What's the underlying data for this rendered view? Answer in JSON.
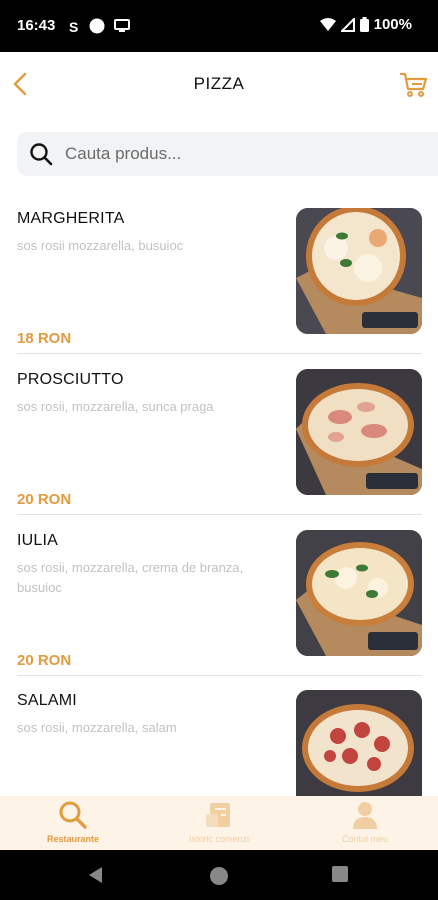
{
  "status": {
    "time": "16:43",
    "battery": "100%"
  },
  "header": {
    "title": "PIZZA",
    "back": "back-icon",
    "cart": "cart-icon"
  },
  "search": {
    "placeholder": "Cauta produs..."
  },
  "products": [
    {
      "name": "MARGHERITA",
      "description": "sos rosii mozzarella, busuioc",
      "price": "18 RON"
    },
    {
      "name": "PROSCIUTTO",
      "description": "sos rosii, mozzarella, sunca praga",
      "price": "20 RON"
    },
    {
      "name": "IULIA",
      "description": "sos rosii, mozzarella, crema de branza, busuioc",
      "price": "20 RON"
    },
    {
      "name": "SALAMI",
      "description": "sos rosii, mozzarella, salam",
      "price": ""
    }
  ],
  "bottom_nav": [
    {
      "label": "Restaurante",
      "icon": "search-icon",
      "active": true
    },
    {
      "label": "Istoric comenzi",
      "icon": "receipt-icon",
      "active": false
    },
    {
      "label": "Contul meu",
      "icon": "user-icon",
      "active": false
    }
  ],
  "colors": {
    "accent": "#e39b3f",
    "nav_bg": "#fdf3e7",
    "search_bg": "#f2f3f5"
  }
}
